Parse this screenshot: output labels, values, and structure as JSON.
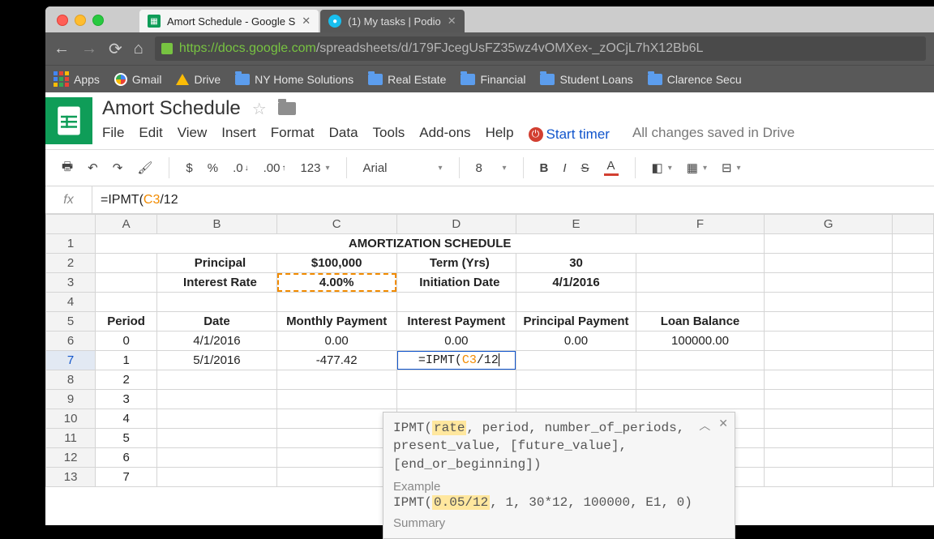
{
  "browser": {
    "tabs": [
      {
        "title": "Amort Schedule - Google S",
        "active": true
      },
      {
        "title": "(1) My tasks | Podio",
        "active": false
      }
    ],
    "url_prefix": "https",
    "url_host": "://docs.google.com",
    "url_path": "/spreadsheets/d/179FJcegUsFZ35wz4vOMXex-_zOCjL7hX12Bb6L",
    "bookmarks": [
      "Apps",
      "Gmail",
      "Drive",
      "NY Home Solutions",
      "Real Estate",
      "Financial",
      "Student Loans",
      "Clarence Secu"
    ]
  },
  "doc": {
    "title": "Amort Schedule",
    "menus": [
      "File",
      "Edit",
      "View",
      "Insert",
      "Format",
      "Data",
      "Tools",
      "Add-ons",
      "Help"
    ],
    "start_timer": "Start timer",
    "saved": "All changes saved in Drive"
  },
  "toolbar": {
    "font": "Arial",
    "size": "8"
  },
  "formula_bar": {
    "prefix": "=IPMT(",
    "ref": "C3",
    "suffix": "/12"
  },
  "columns": [
    "A",
    "B",
    "C",
    "D",
    "E",
    "F",
    "G"
  ],
  "sheet": {
    "title_row": "AMORTIZATION SCHEDULE",
    "row2": {
      "b": "Principal",
      "c": "$100,000",
      "d": "Term (Yrs)",
      "e": "30"
    },
    "row3": {
      "b": "Interest Rate",
      "c": "4.00%",
      "d": "Initiation Date",
      "e": "4/1/2016"
    },
    "headers": {
      "a": "Period",
      "b": "Date",
      "c": "Monthly Payment",
      "d": "Interest Payment",
      "e": "Principal Payment",
      "f": "Loan Balance"
    },
    "rows": [
      {
        "period": "0",
        "date": "4/1/2016",
        "mp": "0.00",
        "ip": "0.00",
        "pp": "0.00",
        "lb": "100000.00"
      },
      {
        "period": "1",
        "date": "5/1/2016",
        "mp": "-477.42",
        "ip_edit": {
          "pre": "=IPMT(",
          "ref": "C3",
          "post": "/12"
        }
      },
      {
        "period": "2"
      },
      {
        "period": "3"
      },
      {
        "period": "4"
      },
      {
        "period": "5"
      },
      {
        "period": "6"
      },
      {
        "period": "7"
      }
    ]
  },
  "tooltip": {
    "fn": "IPMT",
    "sig_pre": "(",
    "arg_hl": "rate",
    "sig_rest": ", period, number_of_periods, present_value, [future_value], [end_or_beginning])",
    "example_label": "Example",
    "example_pre": "IPMT(",
    "example_hl": "0.05/12",
    "example_post": ", 1, 30*12, 100000, E1, 0)",
    "summary_label": "Summary"
  }
}
